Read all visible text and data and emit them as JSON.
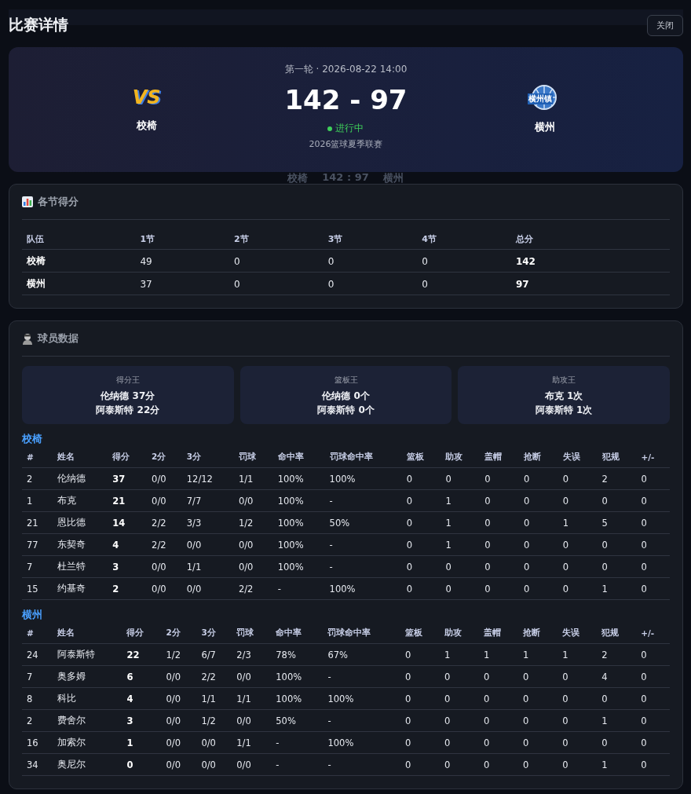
{
  "header": {
    "title": "比赛详情",
    "close_button": "关闭"
  },
  "match": {
    "meta": "第一轮 · 2026-08-22 14:00",
    "home": {
      "name": "校椅",
      "logo_text": "VS"
    },
    "away": {
      "name": "横州",
      "logo_text": "横州镇"
    },
    "score": "142 - 97",
    "status": {
      "label": "进行中",
      "live": true
    },
    "league": "2026篮球夏季联赛"
  },
  "ghost_score": [
    "校椅",
    "142 : 97",
    "横州"
  ],
  "quarters": {
    "title": "各节得分",
    "columns": [
      "队伍",
      "1节",
      "2节",
      "3节",
      "4节",
      "总分"
    ],
    "rows": [
      [
        "校椅",
        "49",
        "0",
        "0",
        "0",
        "142"
      ],
      [
        "横州",
        "37",
        "0",
        "0",
        "0",
        "97"
      ]
    ]
  },
  "players": {
    "title": "球员数据",
    "leaders": [
      {
        "label": "得分王",
        "lines": [
          "伦纳德 37分",
          "阿泰斯特 22分"
        ]
      },
      {
        "label": "篮板王",
        "lines": [
          "伦纳德 0个",
          "阿泰斯特 0个"
        ]
      },
      {
        "label": "助攻王",
        "lines": [
          "布克 1次",
          "阿泰斯特 1次"
        ]
      }
    ],
    "teams": [
      {
        "name": "校椅",
        "columns": [
          "#",
          "姓名",
          "得分",
          "2分",
          "3分",
          "罚球",
          "命中率",
          "罚球命中率",
          "篮板",
          "助攻",
          "盖帽",
          "抢断",
          "失误",
          "犯规",
          "+/-"
        ],
        "rows": [
          [
            "2",
            "伦纳德",
            "37",
            "0/0",
            "12/12",
            "1/1",
            "100%",
            "100%",
            "0",
            "0",
            "0",
            "0",
            "0",
            "2",
            "0"
          ],
          [
            "1",
            "布克",
            "21",
            "0/0",
            "7/7",
            "0/0",
            "100%",
            "-",
            "0",
            "1",
            "0",
            "0",
            "0",
            "0",
            "0"
          ],
          [
            "21",
            "恩比德",
            "14",
            "2/2",
            "3/3",
            "1/2",
            "100%",
            "50%",
            "0",
            "1",
            "0",
            "0",
            "1",
            "5",
            "0"
          ],
          [
            "77",
            "东契奇",
            "4",
            "2/2",
            "0/0",
            "0/0",
            "100%",
            "-",
            "0",
            "1",
            "0",
            "0",
            "0",
            "0",
            "0"
          ],
          [
            "7",
            "杜兰特",
            "3",
            "0/0",
            "1/1",
            "0/0",
            "100%",
            "-",
            "0",
            "0",
            "0",
            "0",
            "0",
            "0",
            "0"
          ],
          [
            "15",
            "约基奇",
            "2",
            "0/0",
            "0/0",
            "2/2",
            "-",
            "100%",
            "0",
            "0",
            "0",
            "0",
            "0",
            "1",
            "0"
          ]
        ]
      },
      {
        "name": "横州",
        "columns": [
          "#",
          "姓名",
          "得分",
          "2分",
          "3分",
          "罚球",
          "命中率",
          "罚球命中率",
          "篮板",
          "助攻",
          "盖帽",
          "抢断",
          "失误",
          "犯规",
          "+/-"
        ],
        "rows": [
          [
            "24",
            "阿泰斯特",
            "22",
            "1/2",
            "6/7",
            "2/3",
            "78%",
            "67%",
            "0",
            "1",
            "1",
            "1",
            "1",
            "2",
            "0"
          ],
          [
            "7",
            "奥多姆",
            "6",
            "0/0",
            "2/2",
            "0/0",
            "100%",
            "-",
            "0",
            "0",
            "0",
            "0",
            "0",
            "4",
            "0"
          ],
          [
            "8",
            "科比",
            "4",
            "0/0",
            "1/1",
            "1/1",
            "100%",
            "100%",
            "0",
            "0",
            "0",
            "0",
            "0",
            "0",
            "0"
          ],
          [
            "2",
            "费舍尔",
            "3",
            "0/0",
            "1/2",
            "0/0",
            "50%",
            "-",
            "0",
            "0",
            "0",
            "0",
            "0",
            "1",
            "0"
          ],
          [
            "16",
            "加索尔",
            "1",
            "0/0",
            "0/0",
            "1/1",
            "-",
            "100%",
            "0",
            "0",
            "0",
            "0",
            "0",
            "0",
            "0"
          ],
          [
            "34",
            "奥尼尔",
            "0",
            "0/0",
            "0/0",
            "0/0",
            "-",
            "-",
            "0",
            "0",
            "0",
            "0",
            "0",
            "1",
            "0"
          ]
        ]
      }
    ]
  }
}
